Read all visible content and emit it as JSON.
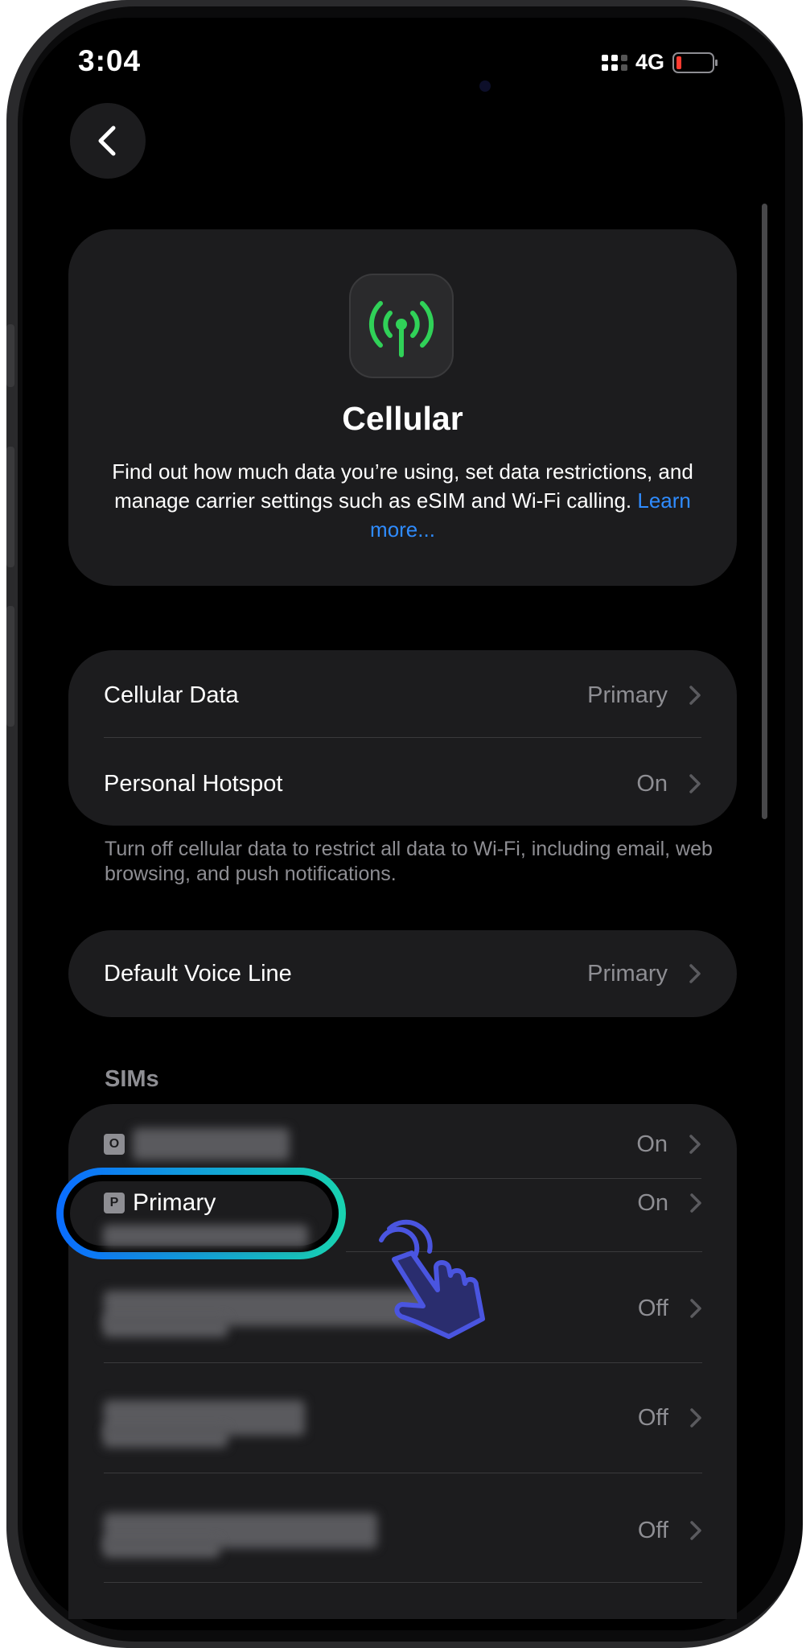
{
  "status_bar": {
    "time": "3:04",
    "network": "4G"
  },
  "hero": {
    "title": "Cellular",
    "description": "Find out how much data you’re using, set data restrictions, and manage carrier settings such as eSIM and Wi-Fi calling.",
    "link": "Learn more..."
  },
  "data_group": {
    "rows": [
      {
        "label": "Cellular Data",
        "value": "Primary"
      },
      {
        "label": "Personal Hotspot",
        "value": "On"
      }
    ],
    "footnote": "Turn off cellular data to restrict all data to Wi-Fi, including email, web browsing, and push notifications."
  },
  "voice_group": {
    "label": "Default Voice Line",
    "value": "Primary"
  },
  "sims": {
    "title": "SIMs",
    "items": [
      {
        "badge": "O",
        "label": "",
        "value": "On"
      },
      {
        "badge": "P",
        "label": "Primary",
        "value": "On"
      },
      {
        "badge": "",
        "label": "",
        "value": "Off"
      },
      {
        "badge": "",
        "label": "",
        "value": "Off"
      },
      {
        "badge": "",
        "label": "",
        "value": "Off"
      }
    ]
  },
  "colors": {
    "accent_green": "#30d158",
    "link_blue": "#2f8cff",
    "highlight_start": "#0a6cff",
    "highlight_end": "#18d3b0",
    "pointer": "#4a55e0"
  },
  "icons": {
    "back": "chevron-left-icon",
    "app": "antenna-icon",
    "pointer": "hand-pointer-icon"
  }
}
